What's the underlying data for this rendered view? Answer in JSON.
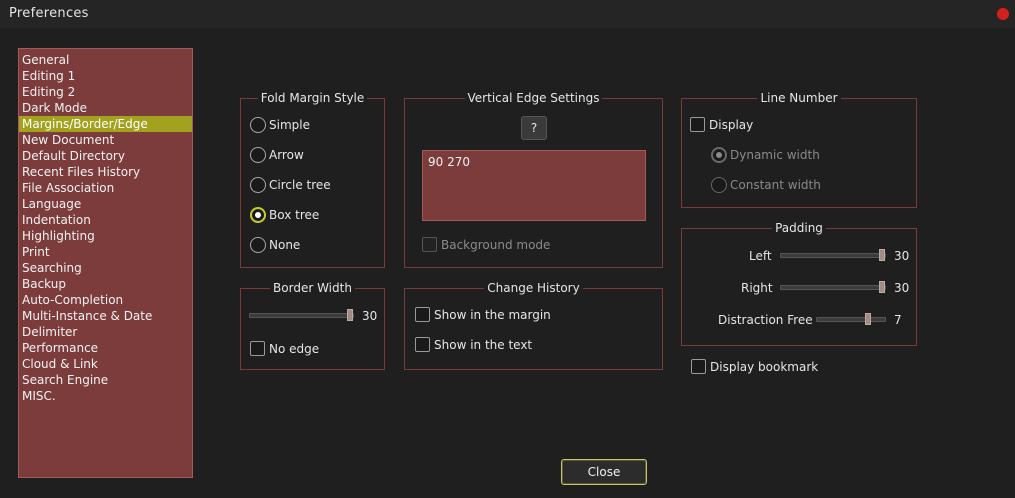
{
  "window": {
    "title": "Preferences"
  },
  "categories": [
    "General",
    "Editing 1",
    "Editing 2",
    "Dark Mode",
    "Margins/Border/Edge",
    "New Document",
    "Default Directory",
    "Recent Files History",
    "File Association",
    "Language",
    "Indentation",
    "Highlighting",
    "Print",
    "Searching",
    "Backup",
    "Auto-Completion",
    "Multi-Instance & Date",
    "Delimiter",
    "Performance",
    "Cloud & Link",
    "Search Engine",
    "MISC."
  ],
  "selected_category": "Margins/Border/Edge",
  "fold_margin": {
    "title": "Fold Margin Style",
    "options": [
      "Simple",
      "Arrow",
      "Circle tree",
      "Box tree",
      "None"
    ],
    "selected": "Box tree"
  },
  "vertical_edge": {
    "title": "Vertical Edge Settings",
    "help_label": "?",
    "value": "90 270",
    "background_mode_label": "Background mode",
    "background_mode_checked": false
  },
  "line_number": {
    "title": "Line Number",
    "display_label": "Display",
    "display_checked": false,
    "dynamic_width_label": "Dynamic width",
    "constant_width_label": "Constant width",
    "selected_width": "Dynamic width"
  },
  "border_width": {
    "title": "Border Width",
    "value": 30,
    "max": 30,
    "no_edge_label": "No edge",
    "no_edge_checked": false
  },
  "change_history": {
    "title": "Change History",
    "show_in_margin_label": "Show in the margin",
    "show_in_margin_checked": false,
    "show_in_text_label": "Show in the text",
    "show_in_text_checked": false
  },
  "padding": {
    "title": "Padding",
    "left_label": "Left",
    "left_value": 30,
    "left_max": 30,
    "right_label": "Right",
    "right_value": 30,
    "right_max": 30,
    "distraction_label": "Distraction Free",
    "distraction_value": 7,
    "distraction_max": 9
  },
  "display_bookmark": {
    "label": "Display bookmark",
    "checked": false
  },
  "close_label": "Close"
}
